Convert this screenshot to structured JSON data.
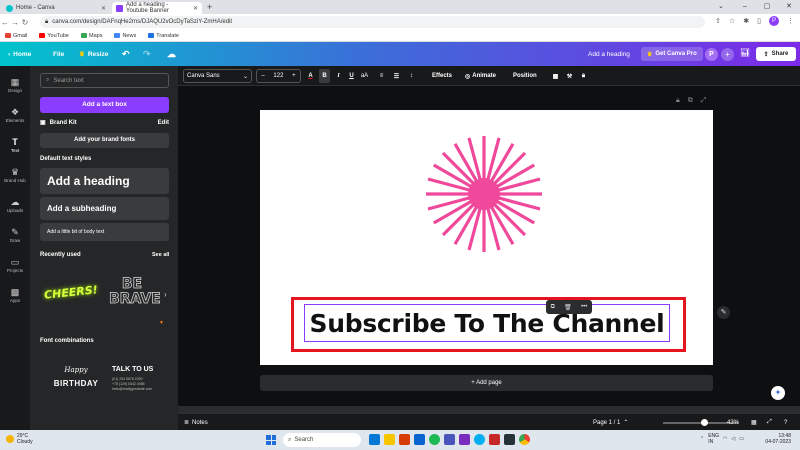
{
  "browser": {
    "tabs": [
      {
        "label": "Home - Canva",
        "active": false
      },
      {
        "label": "Add a heading - Youtube Banner",
        "active": true
      }
    ],
    "url": "canva.com/design/DAFnqHe2rns/DJAQU2vOcDyTaSziY-ZmHA/edit",
    "bookmarks": [
      "Gmail",
      "YouTube",
      "Maps",
      "News",
      "Translate"
    ],
    "profile_initial": "P"
  },
  "header": {
    "home": "Home",
    "file": "File",
    "resize": "Resize",
    "design_title": "Add a heading",
    "get_pro": "Get Canva Pro",
    "avatar": "P",
    "share": "Share",
    "accent": "#8b3dff"
  },
  "rail": [
    {
      "label": "Design",
      "icon": "design-icon",
      "glyph": "▦"
    },
    {
      "label": "Elements",
      "icon": "elements-icon",
      "glyph": "❖"
    },
    {
      "label": "Text",
      "icon": "text-icon",
      "glyph": "T"
    },
    {
      "label": "Brand Hub",
      "icon": "brand-hub-icon",
      "glyph": "♛"
    },
    {
      "label": "Uploads",
      "icon": "uploads-icon",
      "glyph": "☁"
    },
    {
      "label": "Draw",
      "icon": "draw-icon",
      "glyph": "✎"
    },
    {
      "label": "Projects",
      "icon": "projects-icon",
      "glyph": "▭"
    },
    {
      "label": "Apps",
      "icon": "apps-icon",
      "glyph": "▩"
    }
  ],
  "panel": {
    "search_placeholder": "Search text",
    "add_text_box": "Add a text box",
    "brand_kit": "Brand Kit",
    "edit": "Edit",
    "add_brand_fonts": "Add your brand fonts",
    "default_styles_title": "Default text styles",
    "heading": "Add a heading",
    "subheading": "Add a subheading",
    "body": "Add a little bit of body text",
    "recently_used": "Recently used",
    "see_all": "See all",
    "recent_cheers": "CHEERS!",
    "recent_bebrave": "BE BRAVE",
    "font_combinations": "Font combinations",
    "combo_happy": "Happy",
    "combo_birthday": "BIRTHDAY",
    "combo_talk": "TALK TO US",
    "combo_lines": [
      "(01) 234 5678 2290",
      "+78 (129) 0342 4085",
      "hello@reallygreatsite.com"
    ]
  },
  "toolbar": {
    "font": "Canva Sans",
    "size": "122",
    "effects": "Effects",
    "animate": "Animate",
    "position": "Position"
  },
  "canvas": {
    "text": "Subscribe To The Channel",
    "add_page": "+ Add page",
    "sun_color": "#f0489a",
    "highlight_color": "#e5141f"
  },
  "footer": {
    "notes": "Notes",
    "page": "Page 1 / 1",
    "zoom": "43%",
    "zoom_fraction": 0.43
  },
  "taskbar": {
    "temp": "29°C",
    "weather": "Cloudy",
    "search": "Search",
    "lang1": "ENG",
    "lang2": "IN",
    "time": "13:48",
    "date": "04-07-2023"
  }
}
